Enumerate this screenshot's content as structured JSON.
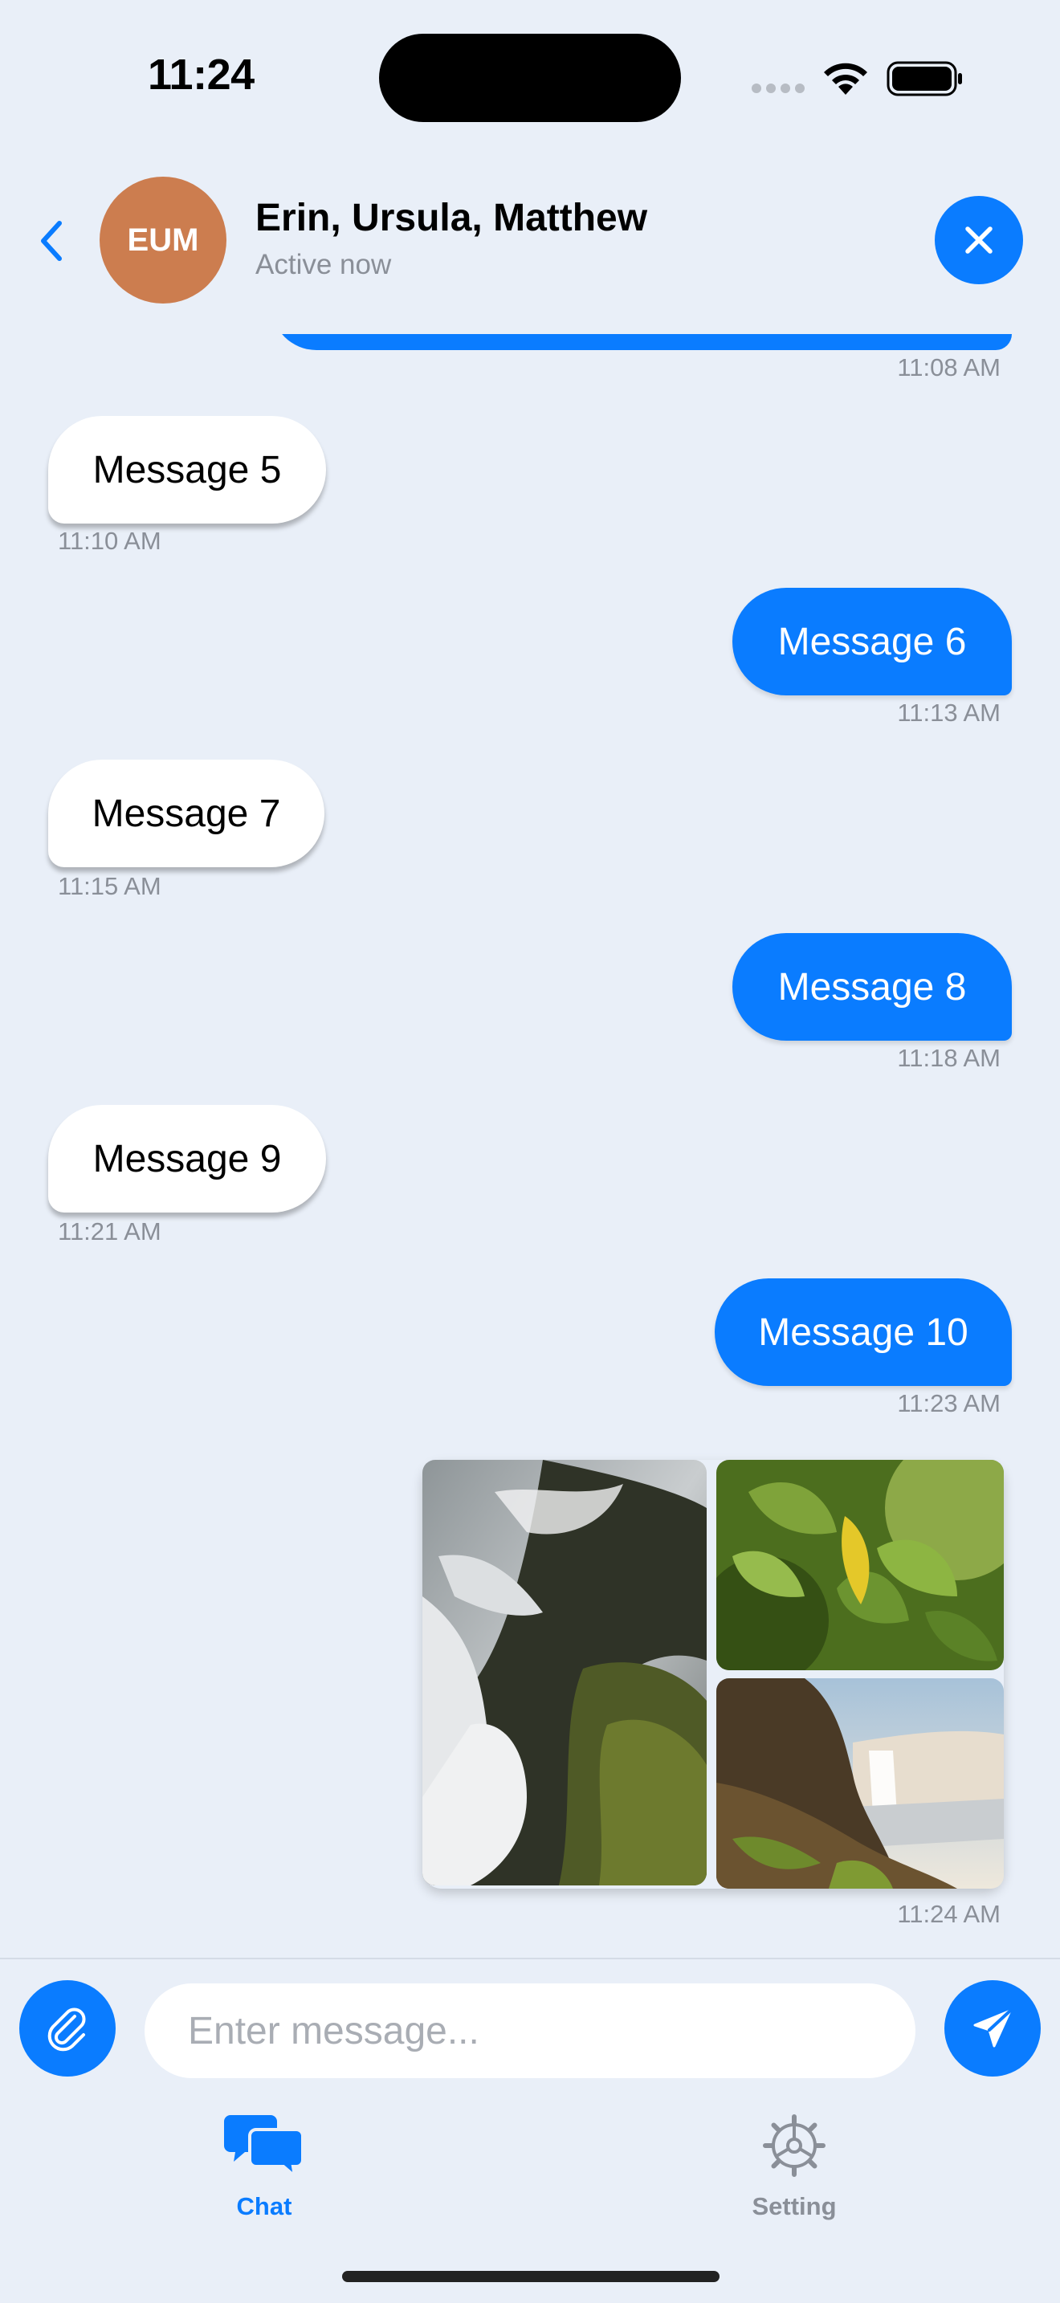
{
  "status_bar": {
    "time": "11:24"
  },
  "header": {
    "avatar_initials": "EUM",
    "title": "Erin, Ursula, Matthew",
    "status": "Active now"
  },
  "messages": [
    {
      "direction": "out",
      "text": "",
      "time": "11:08 AM"
    },
    {
      "direction": "in",
      "text": "Message 5",
      "time": "11:10 AM"
    },
    {
      "direction": "out",
      "text": "Message 6",
      "time": "11:13 AM"
    },
    {
      "direction": "in",
      "text": "Message 7",
      "time": "11:15 AM"
    },
    {
      "direction": "out",
      "text": "Message 8",
      "time": "11:18 AM"
    },
    {
      "direction": "in",
      "text": "Message 9",
      "time": "11:21 AM"
    },
    {
      "direction": "out",
      "text": "Message 10",
      "time": "11:23 AM"
    },
    {
      "direction": "out",
      "type": "photos",
      "photos": [
        "waterfall-rocks",
        "green-leaves",
        "waterfall-cliff"
      ],
      "time": "11:24 AM"
    }
  ],
  "composer": {
    "placeholder": "Enter message..."
  },
  "tabs": [
    {
      "label": "Chat",
      "active": true,
      "icon": "chat-bubbles-icon"
    },
    {
      "label": "Setting",
      "active": false,
      "icon": "gear-icon"
    }
  ],
  "colors": {
    "accent": "#0a7cff",
    "background": "#e9eff8",
    "avatar": "#cc7d4f",
    "secondary_text": "#8a8f98"
  }
}
